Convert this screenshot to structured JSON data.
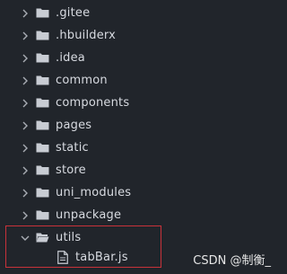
{
  "explorer": {
    "items": [
      {
        "label": ".gitee",
        "kind": "folder",
        "expanded": false
      },
      {
        "label": ".hbuilderx",
        "kind": "folder",
        "expanded": false
      },
      {
        "label": ".idea",
        "kind": "folder",
        "expanded": false
      },
      {
        "label": "common",
        "kind": "folder",
        "expanded": false
      },
      {
        "label": "components",
        "kind": "folder",
        "expanded": false
      },
      {
        "label": "pages",
        "kind": "folder",
        "expanded": false
      },
      {
        "label": "static",
        "kind": "folder",
        "expanded": false
      },
      {
        "label": "store",
        "kind": "folder",
        "expanded": false
      },
      {
        "label": "uni_modules",
        "kind": "folder",
        "expanded": false
      },
      {
        "label": "unpackage",
        "kind": "folder",
        "expanded": false
      },
      {
        "label": "utils",
        "kind": "folder",
        "expanded": true
      },
      {
        "label": "tabBar.js",
        "kind": "file"
      }
    ]
  },
  "watermark": {
    "text": "CSDN @制衡_"
  },
  "colors": {
    "background": "#21252b",
    "text": "#d7dae0",
    "icon": "#c8ccd3",
    "chevron": "#a9adb4",
    "highlight_border": "#c8323a"
  },
  "icons": {
    "collapsed": "chevron-right-icon",
    "expanded": "chevron-down-icon",
    "folder": "folder-icon",
    "file": "file-icon"
  }
}
